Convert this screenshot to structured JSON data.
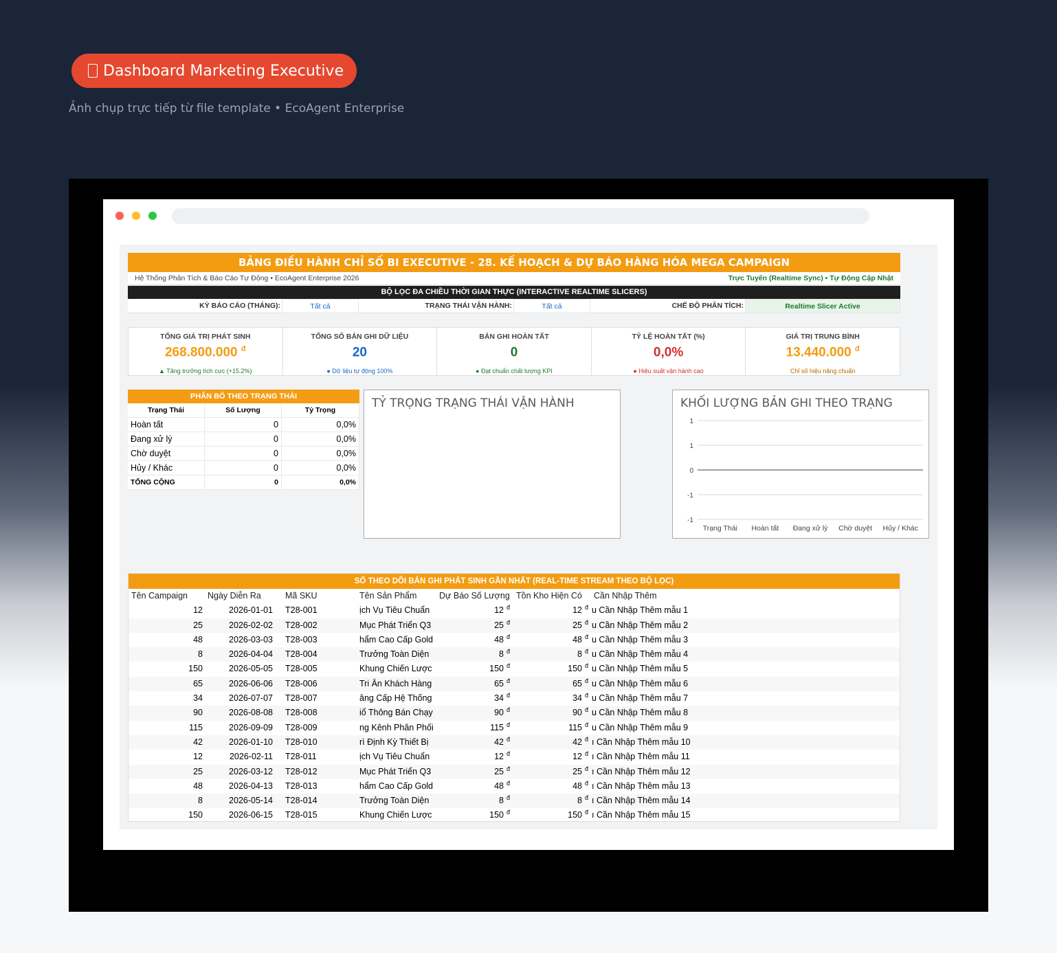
{
  "header": {
    "badge_icon": "document-icon",
    "badge_title": "Dashboard Marketing Executive",
    "subtitle": "Ảnh chụp trực tiếp từ file template • EcoAgent Enterprise"
  },
  "report": {
    "title": "BẢNG ĐIỀU HÀNH CHỈ SỐ BI EXECUTIVE - 28. KẾ HOẠCH & DỰ BÁO HÀNG HÓA MEGA CAMPAIGN",
    "system_label": "Hệ Thống Phân Tích & Báo Cáo Tự Động • EcoAgent Enterprise 2026",
    "status_label": "Trực Tuyến (Realtime Sync) • Tự Động Cập Nhật"
  },
  "slicers": {
    "title": "BỘ LỌC ĐA CHIỀU THỜI GIAN THỰC (INTERACTIVE REALTIME SLICERS)",
    "period_label": "KỲ BÁO CÁO (THÁNG):",
    "period_value": "Tất cả",
    "state_label": "TRẠNG THÁI VẬN HÀNH:",
    "state_value": "Tất cả",
    "mode_label": "CHẾ ĐỘ PHÂN TÍCH:",
    "mode_value": "Realtime Slicer Active"
  },
  "kpis": [
    {
      "label": "TỔNG GIÁ TRỊ PHÁT SINH",
      "value": "268.800.000",
      "unit": "đ",
      "note": "▲ Tăng trưởng tích cực (+15.2%)",
      "color": "#f39c12",
      "note_color": "#1f7a2f"
    },
    {
      "label": "TỔNG SỐ BẢN GHI DỮ LIỆU",
      "value": "20",
      "unit": "",
      "note": "● Dữ liệu tự động 100%",
      "color": "#1a66c9",
      "note_color": "#1a66c9"
    },
    {
      "label": "BẢN GHI HOÀN TẤT",
      "value": "0",
      "unit": "",
      "note": "● Đạt chuẩn chất lượng KPI",
      "color": "#1f7a2f",
      "note_color": "#1f7a2f"
    },
    {
      "label": "TỶ LỆ HOÀN TẤT (%)",
      "value": "0,0%",
      "unit": "",
      "note": "● Hiệu suất vận hành cao",
      "color": "#d32f2f",
      "note_color": "#d32f2f"
    },
    {
      "label": "GIÁ TRỊ TRUNG BÌNH",
      "value": "13.440.000",
      "unit": "đ",
      "note": "Chỉ số hiệu năng chuẩn",
      "color": "#f39c12",
      "note_color": "#b36b00"
    }
  ],
  "status_table": {
    "title": "PHÂN BỔ THEO TRẠNG THÁI",
    "headers": [
      "Trạng Thái",
      "Số Lượng",
      "Tỷ Trọng"
    ],
    "rows": [
      [
        "Hoàn tất",
        "0",
        "0,0%"
      ],
      [
        "Đang xử lý",
        "0",
        "0,0%"
      ],
      [
        "Chờ duyệt",
        "0",
        "0,0%"
      ],
      [
        "Hủy / Khác",
        "0",
        "0,0%"
      ]
    ],
    "total": [
      "TỔNG CỘNG",
      "0",
      "0,0%"
    ]
  },
  "pie_chart": {
    "title": "TỶ TRỌNG TRẠNG THÁI VẬN HÀNH"
  },
  "chart_data": {
    "type": "bar",
    "title": "KHỐI LƯỢNG BẢN GHI THEO TRẠNG",
    "categories": [
      "Trạng Thái",
      "Hoàn tất",
      "Đang xử lý",
      "Chờ duyệt",
      "Hủy / Khác"
    ],
    "values": [
      0,
      0,
      0,
      0,
      0
    ],
    "y_ticks": [
      "1",
      "1",
      "0",
      "-1",
      "-1"
    ],
    "ylim": [
      -1,
      1
    ],
    "grid": true
  },
  "log": {
    "title": "SỔ THEO DÕI BẢN GHI PHÁT SINH GẦN NHẤT (REAL-TIME STREAM THEO BỘ LỌC)",
    "headers": [
      "Tên Campaign",
      "Ngày Diễn Ra",
      "Mã SKU",
      "Tên Sản Phẩm",
      "Dự Báo Số Lượng",
      "Tồn Kho Hiện Có",
      "Cần Nhập Thêm"
    ],
    "rows": [
      [
        "12",
        "2026-01-01",
        "T28-001",
        "ịch Vụ Tiêu Chuẩn",
        "12",
        "đ",
        "12",
        "đ",
        "u Cần Nhập Thêm mẫu 1"
      ],
      [
        "25",
        "2026-02-02",
        "T28-002",
        "Mục Phát Triển Q3",
        "25",
        "đ",
        "25",
        "đ",
        "u Cần Nhập Thêm mẫu 2"
      ],
      [
        "48",
        "2026-03-03",
        "T28-003",
        "hẩm Cao Cấp Gold",
        "48",
        "đ",
        "48",
        "đ",
        "u Cần Nhập Thêm mẫu 3"
      ],
      [
        "8",
        "2026-04-04",
        "T28-004",
        "Trưởng Toàn Diện",
        "8",
        "đ",
        "8",
        "đ",
        "u Cần Nhập Thêm mẫu 4"
      ],
      [
        "150",
        "2026-05-05",
        "T28-005",
        "Khung Chiến Lược",
        "150",
        "đ",
        "150",
        "đ",
        "u Cần Nhập Thêm mẫu 5"
      ],
      [
        "65",
        "2026-06-06",
        "T28-006",
        "Tri Ân Khách Hàng",
        "65",
        "đ",
        "65",
        "đ",
        "u Cần Nhập Thêm mẫu 6"
      ],
      [
        "34",
        "2026-07-07",
        "T28-007",
        "âng Cấp Hệ Thống",
        "34",
        "đ",
        "34",
        "đ",
        "u Cần Nhập Thêm mẫu 7"
      ],
      [
        "90",
        "2026-08-08",
        "T28-008",
        "iổ Thông Bán Chạy",
        "90",
        "đ",
        "90",
        "đ",
        "u Cần Nhập Thêm mẫu 8"
      ],
      [
        "115",
        "2026-09-09",
        "T28-009",
        "ng Kênh Phân Phối",
        "115",
        "đ",
        "115",
        "đ",
        "u Cần Nhập Thêm mẫu 9"
      ],
      [
        "42",
        "2026-01-10",
        "T28-010",
        "rì Định Kỳ Thiết Bị",
        "42",
        "đ",
        "42",
        "đ",
        "ı Cần Nhập Thêm mẫu 10"
      ],
      [
        "12",
        "2026-02-11",
        "T28-011",
        "ịch Vụ Tiêu Chuẩn",
        "12",
        "đ",
        "12",
        "đ",
        "ı Cần Nhập Thêm mẫu 11"
      ],
      [
        "25",
        "2026-03-12",
        "T28-012",
        "Mục Phát Triển Q3",
        "25",
        "đ",
        "25",
        "đ",
        "ı Cần Nhập Thêm mẫu 12"
      ],
      [
        "48",
        "2026-04-13",
        "T28-013",
        "hẩm Cao Cấp Gold",
        "48",
        "đ",
        "48",
        "đ",
        "ı Cần Nhập Thêm mẫu 13"
      ],
      [
        "8",
        "2026-05-14",
        "T28-014",
        "Trưởng Toàn Diện",
        "8",
        "đ",
        "8",
        "đ",
        "ı Cần Nhập Thêm mẫu 14"
      ],
      [
        "150",
        "2026-06-15",
        "T28-015",
        "Khung Chiến Lược",
        "150",
        "đ",
        "150",
        "đ",
        "ı Cần Nhập Thêm mẫu 15"
      ]
    ]
  },
  "colors": {
    "accent_orange": "#f39c12",
    "badge_red": "#e5482f",
    "background_navy": "#1b2538"
  }
}
